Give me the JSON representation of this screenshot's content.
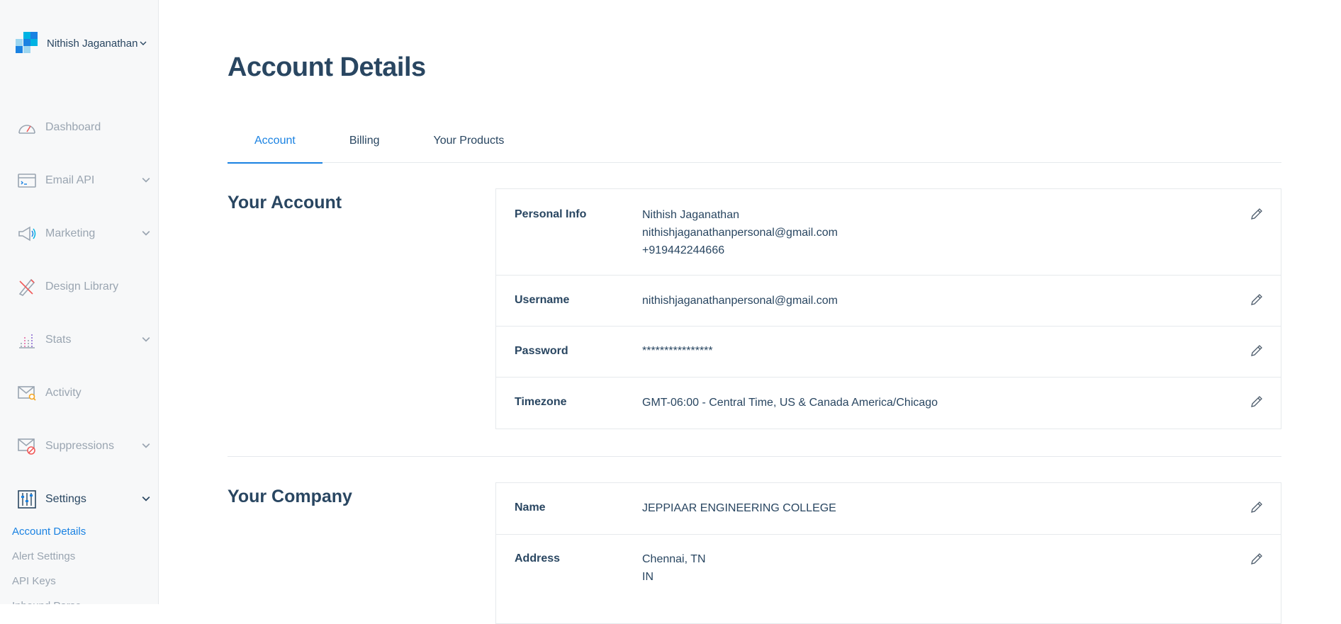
{
  "account": {
    "name": "Nithish Jaganathan"
  },
  "nav": {
    "items": [
      {
        "label": "Dashboard",
        "icon": "dashboard-gauge-icon",
        "has_chevron": false
      },
      {
        "label": "Email API",
        "icon": "email-api-icon",
        "has_chevron": true
      },
      {
        "label": "Marketing",
        "icon": "megaphone-icon",
        "has_chevron": true
      },
      {
        "label": "Design Library",
        "icon": "design-pencil-ruler-icon",
        "has_chevron": false
      },
      {
        "label": "Stats",
        "icon": "stats-bars-icon",
        "has_chevron": true
      },
      {
        "label": "Activity",
        "icon": "activity-envelope-search-icon",
        "has_chevron": false
      },
      {
        "label": "Suppressions",
        "icon": "suppressions-envelope-block-icon",
        "has_chevron": true
      },
      {
        "label": "Settings",
        "icon": "settings-sliders-icon",
        "has_chevron": true
      }
    ],
    "settings_sub": [
      "Account Details",
      "Alert Settings",
      "API Keys",
      "Inbound Parse"
    ]
  },
  "page": {
    "title": "Account Details"
  },
  "tabs": [
    "Account",
    "Billing",
    "Your Products"
  ],
  "your_account": {
    "title": "Your Account",
    "personal_info": {
      "label": "Personal Info",
      "name": "Nithish Jaganathan",
      "email": "nithishjaganathanpersonal@gmail.com",
      "phone": "+919442244666"
    },
    "username": {
      "label": "Username",
      "value": "nithishjaganathanpersonal@gmail.com"
    },
    "password": {
      "label": "Password",
      "value": "****************"
    },
    "timezone": {
      "label": "Timezone",
      "value": "GMT-06:00 - Central Time, US & Canada America/Chicago"
    }
  },
  "your_company": {
    "title": "Your Company",
    "name": {
      "label": "Name",
      "value": "JEPPIAAR ENGINEERING COLLEGE"
    },
    "address": {
      "label": "Address",
      "line1": "Chennai, TN",
      "line2": "IN"
    }
  },
  "colors": {
    "accent": "#1a82e2",
    "text": "#294661",
    "muted": "#9aa5b1",
    "border": "#e6e9ec"
  }
}
